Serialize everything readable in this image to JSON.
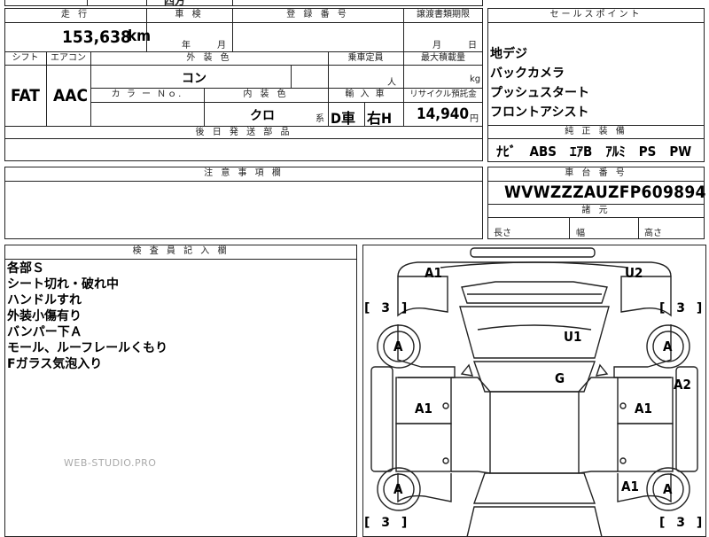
{
  "top_cut": "四方",
  "headers": {
    "mileage": "走 行",
    "inspection": "車 検",
    "registration": "登 録 番 号",
    "transfer_deadline": "譲渡書類期限",
    "shift": "シフト",
    "aircon": "エアコン",
    "exterior_color": "外 装 色",
    "capacity": "乗車定員",
    "max_load": "最大積載量",
    "color_no": "カ ラ ー Ｎｏ.",
    "interior_color": "内 装 色",
    "import": "輸 入 車",
    "recycle": "リサイクル預託金",
    "later_parts": "後 日 発 送 部 品",
    "notes": "注 意 事 項 欄",
    "sales_points": "セールスポイント",
    "equipment": "純 正 装 備",
    "chassis": "車 台 番 号",
    "dimensions": "諸 元",
    "inspector": "検 査 員 記 入 欄"
  },
  "values": {
    "mileage": "153,638",
    "mileage_unit": "km",
    "year_unit": "年",
    "month_unit": "月",
    "transfer_month": "月",
    "transfer_day": "日",
    "shift": "FAT",
    "aircon": "AAC",
    "exterior_color": "コン",
    "capacity_unit": "人",
    "load_unit": "kg",
    "interior_color": "クロ",
    "interior_suffix": "系",
    "import_type": "D車",
    "steering": "右H",
    "recycle_fee": "14,940",
    "recycle_unit": "円",
    "chassis_number": "WVWZZZAUZFP609894",
    "dim_length": "長さ",
    "dim_width": "幅",
    "dim_height": "高さ"
  },
  "sales_points": [
    "地デジ",
    "バックカメラ",
    "プッシュスタート",
    "フロントアシスト"
  ],
  "equipment": "ﾅﾋﾞ　ABS　ｴｱB　ｱﾙﾐ　PS　PW",
  "inspector_notes": [
    "各部Ｓ",
    "シート切れ・破れ中",
    "ハンドルすれ",
    "外装小傷有り",
    "バンパー下Ａ",
    "モール、ルーフレールくもり",
    "Fガラス気泡入り"
  ],
  "watermark": "WEB-STUDIO.PRO",
  "diagram": {
    "marks": {
      "front_left": "A1",
      "front_right": "U2",
      "hood": "U1",
      "roof": "G",
      "left_door": "A1",
      "right_door": "A1",
      "right_rear_fender": "A1",
      "right_side": "A2",
      "wheel_fl": "A",
      "wheel_fr": "A",
      "wheel_rl": "A",
      "wheel_rr": "A"
    },
    "tread": {
      "fl": "[ 3 ]",
      "fr": "[ 3 ]",
      "rl": "[ 3 ]",
      "rr": "[ 3 ]"
    }
  }
}
